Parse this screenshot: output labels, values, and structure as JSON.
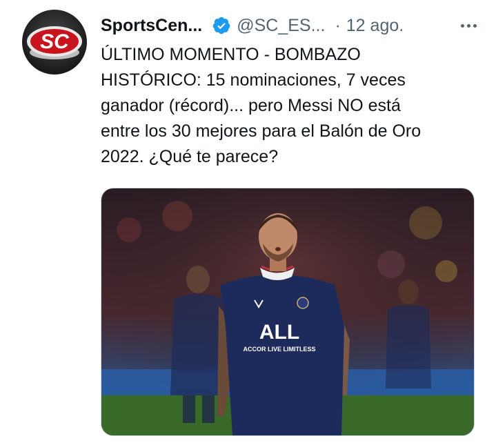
{
  "tweet": {
    "author": {
      "display_name": "SportsCen...",
      "handle": "@SC_ES...",
      "avatar_text": "SC",
      "verified": true
    },
    "separator": "·",
    "timestamp": "12 ago.",
    "text_lines": [
      "ÚLTIMO MOMENTO - BOMBAZO",
      "HISTÓRICO: 15 nominaciones, 7 veces",
      "ganador (récord)... pero Messi NO está",
      "entre los 30 mejores para el Balón de Oro",
      "2022. ¿Qué te parece?"
    ],
    "media": {
      "kit_brand": "ALL",
      "kit_sponsor": "ACCOR LIVE LIMITLESS"
    }
  },
  "colors": {
    "text": "#0f1419",
    "secondary": "#536471",
    "verified": "#1d9bf0",
    "border": "#cfd9de"
  },
  "icons": {
    "verified": "verified-badge-icon",
    "more": "more-horizontal-icon"
  }
}
